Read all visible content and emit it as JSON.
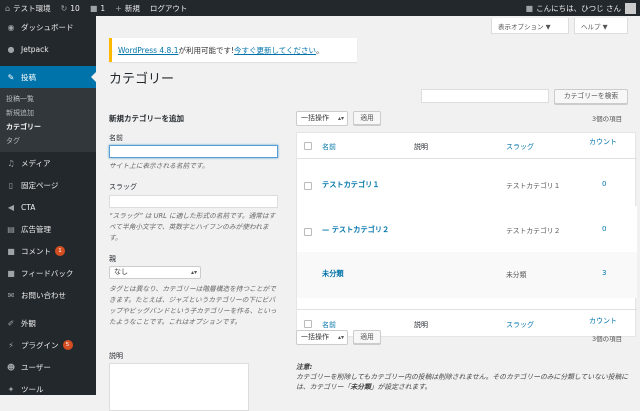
{
  "adminbar": {
    "site": "テスト環境",
    "updates": "10",
    "comments": "1",
    "new": "新規",
    "logout": "ログアウト",
    "greeting": "こんにちは、ひつじ さん"
  },
  "sidebar": {
    "dashboard": "ダッシュボード",
    "jetpack": "Jetpack",
    "posts": "投稿",
    "sub": [
      "投稿一覧",
      "新規追加",
      "カテゴリー",
      "タグ"
    ],
    "media": "メディア",
    "pages": "固定ページ",
    "cta": "CTA",
    "ads": "広告管理",
    "comments": "コメント",
    "comments_badge": "1",
    "feedback": "フィードバック",
    "contact": "お問い合わせ",
    "appearance": "外観",
    "plugins": "プラグイン",
    "plugins_badge": "5",
    "users": "ユーザー",
    "tools": "ツール"
  },
  "screen": {
    "options": "表示オプション ▼",
    "help": "ヘルプ ▼"
  },
  "notice": {
    "prefix": "WordPress 4.8.1",
    "middle": " が利用可能です! ",
    "link": "今すぐ更新してください",
    "suffix": "。"
  },
  "page": {
    "title": "カテゴリー",
    "search_button": "カテゴリーを検索"
  },
  "form": {
    "heading": "新規カテゴリーを追加",
    "name_label": "名前",
    "name_desc": "サイト上に表示される名前です。",
    "slug_label": "スラッグ",
    "slug_desc": "“スラッグ” は URL に適した形式の名前です。通常はすべて半角小文字で、英数字とハイフンのみが使われます。",
    "parent_label": "親",
    "parent_value": "なし",
    "parent_desc": "タグとは異なり、カテゴリーは階層構造を持つことができます。たとえば、ジャズというカテゴリーの下にビバップやビッグバンドという子カテゴリーを作る、といったようなことです。これはオプションです。",
    "desc_label": "説明"
  },
  "bulk": {
    "label": "一括操作",
    "apply": "適用",
    "count": "3個の項目"
  },
  "table": {
    "headers": {
      "name": "名前",
      "description": "説明",
      "slug": "スラッグ",
      "count": "カウント"
    },
    "rows": [
      {
        "name": "テストカテゴリ１",
        "slug": "テストカテゴリ１",
        "count": "0"
      },
      {
        "name": "— テストカテゴリ２",
        "slug": "テストカテゴリ２",
        "count": "0"
      },
      {
        "name": "未分類",
        "slug": "未分類",
        "count": "3"
      }
    ]
  },
  "note": {
    "title": "注意:",
    "text": "カテゴリーを削除してもカテゴリー内の投稿は削除されません。そのカテゴリーのみに分類していない投稿には、カテゴリー「",
    "bold": "未分類",
    "tail": "」が設定されます。"
  }
}
